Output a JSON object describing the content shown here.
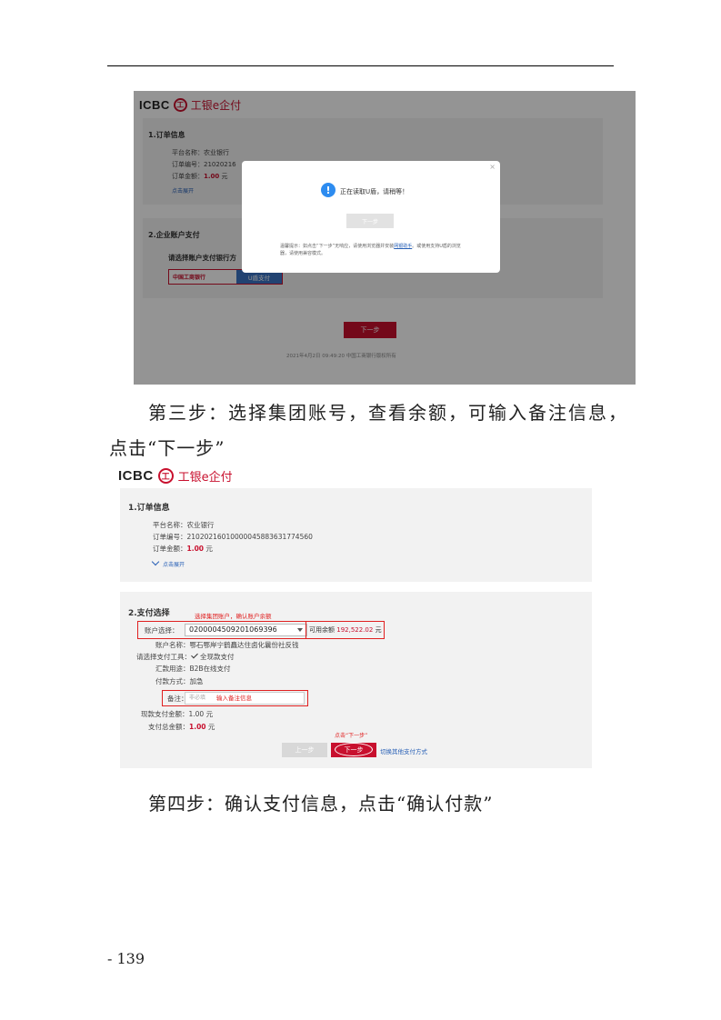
{
  "shot1": {
    "logo": {
      "icbc": "ICBC",
      "seal": "工",
      "brand": "工银e企付"
    },
    "order_heading": "1.订单信息",
    "order_lines": [
      "平台名称：农业银行",
      "订单编号：21020216"
    ],
    "order_amount_label": "订单金额：",
    "order_amount": "1.00",
    "order_amount_unit": "元",
    "expand": "点击展开",
    "pay_heading": "2.企业账户支付",
    "choose": "请选择账户支付银行方",
    "bank": "中国工商银行",
    "ushield": "U盾支付",
    "next_button": "下一步",
    "footer": "2021年4月2日 09:49:20 中国工商银行版权所有",
    "modal": {
      "close": "×",
      "info_icon": "!",
      "message": "正在读取U盾，请稍等！",
      "button": "下一步",
      "tip_text": "温馨提示：如点击“下一步”无响应，请使用浏览器并安装",
      "tip_link": "网银助手",
      "tip_rest": "。或使用支持U盾的浏览器，请使用兼容模式。"
    }
  },
  "para1_line1": "第三步：选择集团账号，查看余额，可输入备注信息，",
  "para1_line2": "点击“下一步”",
  "shot2": {
    "logo": {
      "icbc": "ICBC",
      "seal": "工",
      "brand": "工银e企付"
    },
    "order_heading": "1.订单信息",
    "platform": "平台名称：农业银行",
    "order_no": "订单编号：21020216010000045883631774560",
    "amount_label": "订单金额：",
    "amount": "1.00",
    "amount_unit": "元",
    "expand": "点击展开",
    "pay_heading": "2.支付选择",
    "anno_account": "选择集团账户，确认账户余额",
    "account_label": "账户选择：",
    "account_value": "0200004509201069396",
    "avail_label": "可用余额",
    "avail_amount": "192,522.02",
    "avail_unit": "元",
    "account_name": "账户名称：鄂石鄂岸宁鹤矗达住卤化曩份社反钱",
    "tool_label": "请选择支付工具：",
    "tool_value": "全现款支付",
    "remit_use": "汇款用途：B2B在线支付",
    "pay_method": "付款方式：加急",
    "remark_label": "备注：",
    "remark_placeholder": "非必填",
    "remark_anno": "输入备注信息",
    "cash_total": "现款支付金额：1.00 元",
    "total_label": "支付总金额：",
    "total_amount": "1.00",
    "total_unit": "元",
    "next_anno": "点击“下一步”",
    "prev_button": "上一步",
    "next_button": "下一步",
    "switch_link": "切换其他支付方式"
  },
  "para2": "第四步：确认支付信息，点击“确认付款”",
  "page_number": "- 139",
  "colors": {
    "icbc_red": "#c8102e",
    "annotation_red": "#e02020",
    "link_blue": "#2860b6"
  }
}
